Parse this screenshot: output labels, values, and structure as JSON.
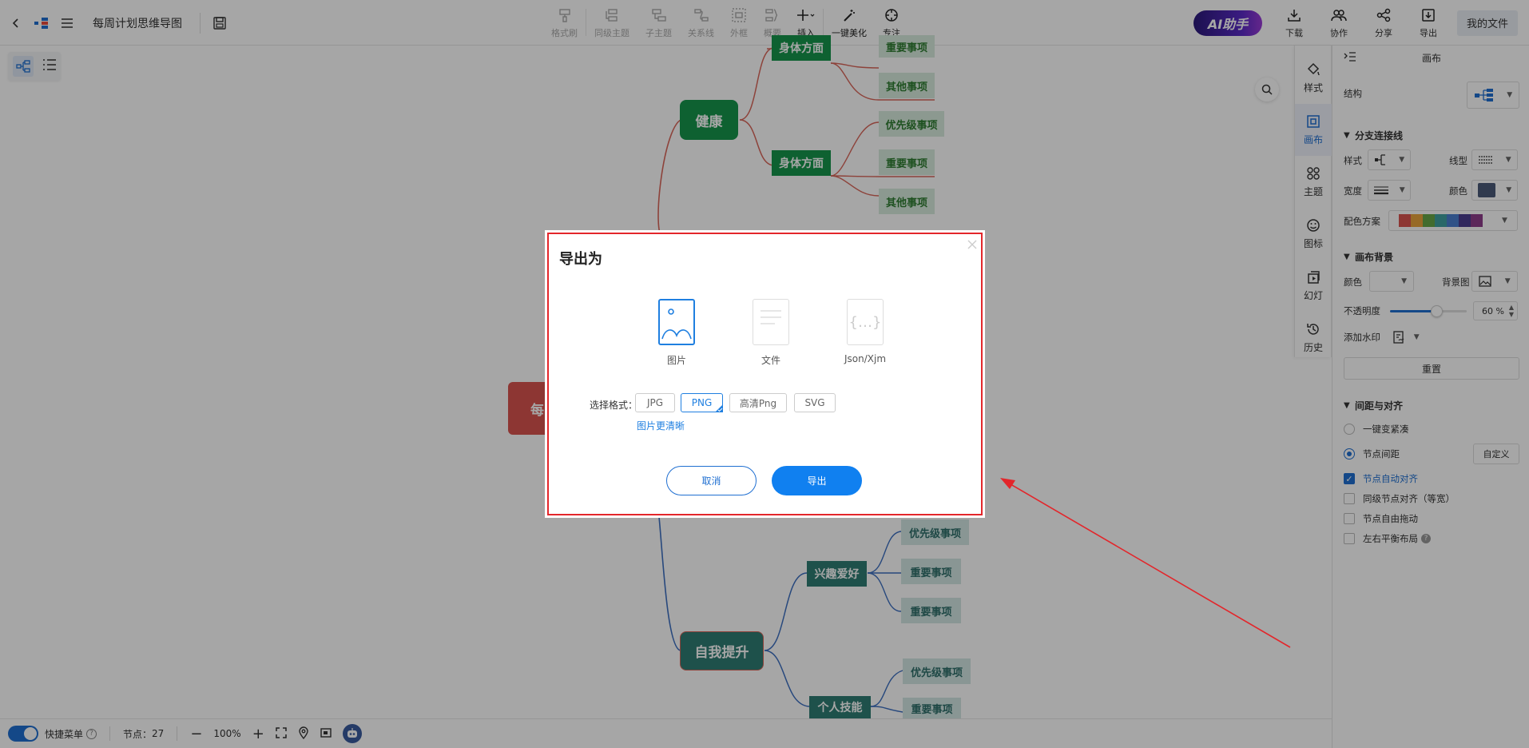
{
  "topbar": {
    "title": "每周计划思维导图",
    "tools": [
      "格式刷",
      "同级主题",
      "子主题",
      "关系线",
      "外框",
      "概要",
      "插入",
      "一键美化",
      "专注"
    ],
    "ai_label": "AI助手",
    "right_tools": [
      "下载",
      "协作",
      "分享",
      "导出"
    ],
    "my_files": "我的文件"
  },
  "mindmap": {
    "health": "健康",
    "body_top": "身体方面",
    "body": "身体方面",
    "leaf_important_top": "重要事项",
    "leaf_other_top": "其他事项",
    "leaf_priority": "优先级事项",
    "leaf_important": "重要事项",
    "leaf_other": "其他事项",
    "root_partial": "每",
    "hobby": "兴趣爱好",
    "hobby_priority": "优先级事项",
    "hobby_imp1": "重要事项",
    "hobby_imp2": "重要事项",
    "self_improve": "自我提升",
    "skill": "个人技能",
    "skill_priority": "优先级事项",
    "skill_imp": "重要事项"
  },
  "side_tabs": [
    "样式",
    "画布",
    "主题",
    "图标",
    "幻灯",
    "历史"
  ],
  "panel": {
    "title": "画布",
    "structure_label": "结构",
    "branch_section": "分支连接线",
    "style_label": "样式",
    "line_type_label": "线型",
    "width_label": "宽度",
    "color_label": "颜色",
    "scheme_label": "配色方案",
    "scheme_colors": [
      "#d9534f",
      "#e8a33d",
      "#66a648",
      "#3fa0a0",
      "#4a7fcf",
      "#4a3d8f",
      "#8e3d8a"
    ],
    "bg_section": "画布背景",
    "bg_color_label": "颜色",
    "bg_image_label": "背景图",
    "opacity_label": "不透明度",
    "opacity_value": "60",
    "opacity_unit": "%",
    "watermark_label": "添加水印",
    "reset_label": "重置",
    "spacing_section": "间距与对齐",
    "compact_label": "一键变紧凑",
    "node_spacing_label": "节点间距",
    "custom_label": "自定义",
    "auto_align_label": "节点自动对齐",
    "same_level_label": "同级节点对齐（等宽）",
    "free_drag_label": "节点自由拖动",
    "balance_label": "左右平衡布局"
  },
  "bottombar": {
    "quick_menu": "快捷菜单",
    "nodes_label": "节点：",
    "nodes_count": "27",
    "zoom": "100%"
  },
  "dialog": {
    "title": "导出为",
    "formats": [
      "图片",
      "文件",
      "Json/Xjm"
    ],
    "select_label": "选择格式：",
    "options": [
      "JPG",
      "PNG",
      "高清Png",
      "SVG"
    ],
    "selected_option": "PNG",
    "clear_link": "图片更清晰",
    "cancel": "取消",
    "export": "导出"
  },
  "colors": {
    "accent": "#1f6fd1",
    "highlight": "#e3262b",
    "health_node": "#16964c",
    "root_node": "#d9534f",
    "self_node": "#2f7d73"
  }
}
